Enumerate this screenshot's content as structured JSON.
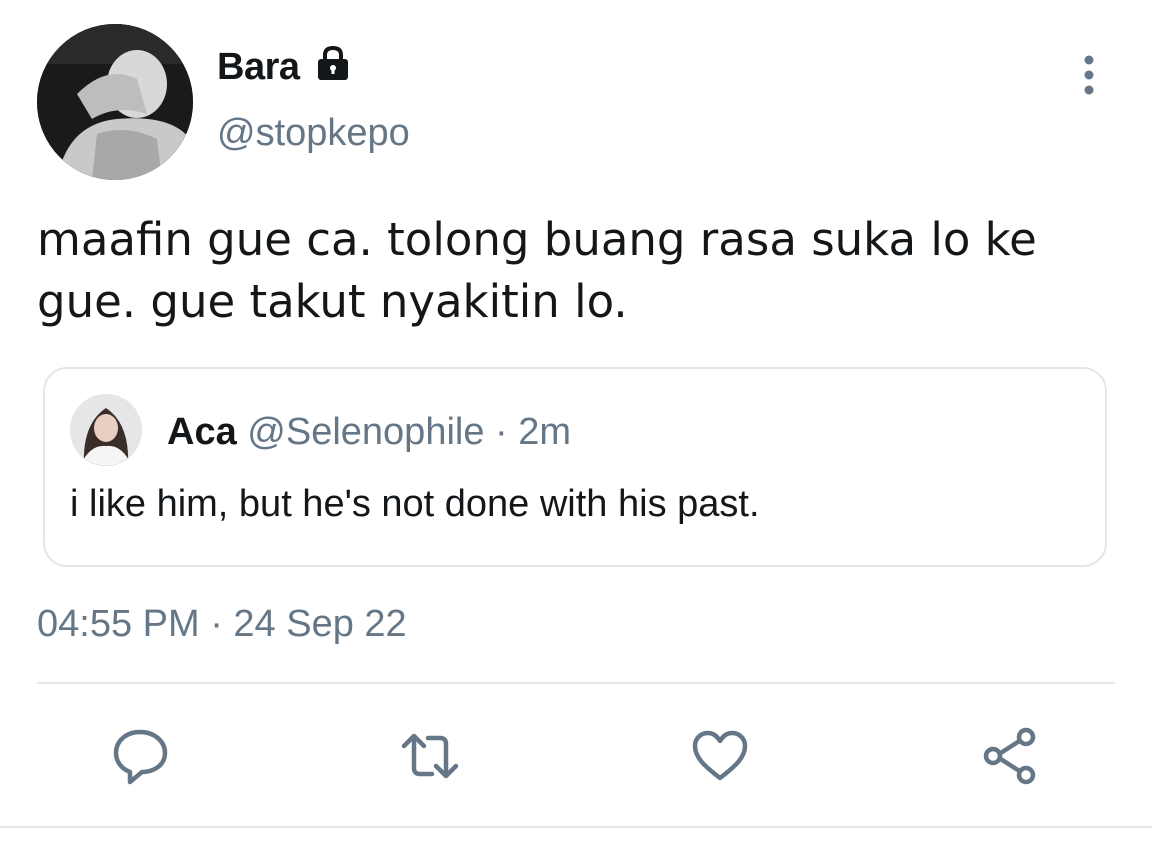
{
  "tweet": {
    "author": {
      "display_name": "Bara",
      "handle": "@stopkepo",
      "protected_icon": "lock-icon"
    },
    "text": "maafin gue ca. tolong buang rasa suka lo ke gue. gue takut nyakitin lo.",
    "quoted": {
      "display_name": "Aca",
      "handle": "@Selenophile",
      "separator": "·",
      "time": "2m",
      "text": "i like him, but he's not done with his past."
    },
    "timestamp": "04:55 PM · 24 Sep 22",
    "more_icon": "more-vertical-icon"
  },
  "actions": [
    {
      "name": "reply",
      "icon": "reply-icon"
    },
    {
      "name": "retweet",
      "icon": "retweet-icon"
    },
    {
      "name": "like",
      "icon": "heart-icon"
    },
    {
      "name": "share",
      "icon": "share-icon"
    }
  ],
  "colors": {
    "text_primary": "#14171a",
    "text_secondary": "#657786",
    "border": "#e1e8ed",
    "icon": "#657786"
  }
}
